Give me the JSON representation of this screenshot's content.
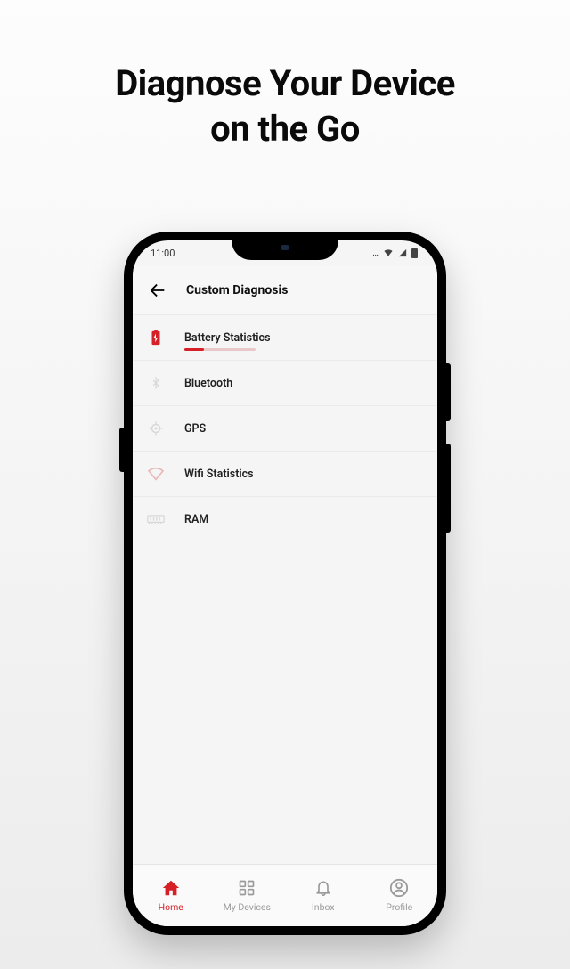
{
  "marketing": {
    "line1": "Diagnose Your Device",
    "line2": "on the Go"
  },
  "statusbar": {
    "time": "11:00"
  },
  "header": {
    "title": "Custom Diagnosis"
  },
  "diagnosis": {
    "items": [
      {
        "label": "Battery Statistics",
        "icon": "battery",
        "active": true,
        "progress": 28
      },
      {
        "label": "Bluetooth",
        "icon": "bluetooth",
        "active": false
      },
      {
        "label": "GPS",
        "icon": "gps",
        "active": false
      },
      {
        "label": "Wifi Statistics",
        "icon": "wifi",
        "active": false
      },
      {
        "label": "RAM",
        "icon": "ram",
        "active": false
      }
    ]
  },
  "nav": {
    "items": [
      {
        "label": "Home",
        "icon": "home",
        "active": true
      },
      {
        "label": "My Devices",
        "icon": "devices",
        "active": false
      },
      {
        "label": "Inbox",
        "icon": "bell",
        "active": false
      },
      {
        "label": "Profile",
        "icon": "profile",
        "active": false
      }
    ]
  },
  "colors": {
    "accent": "#d62027"
  }
}
